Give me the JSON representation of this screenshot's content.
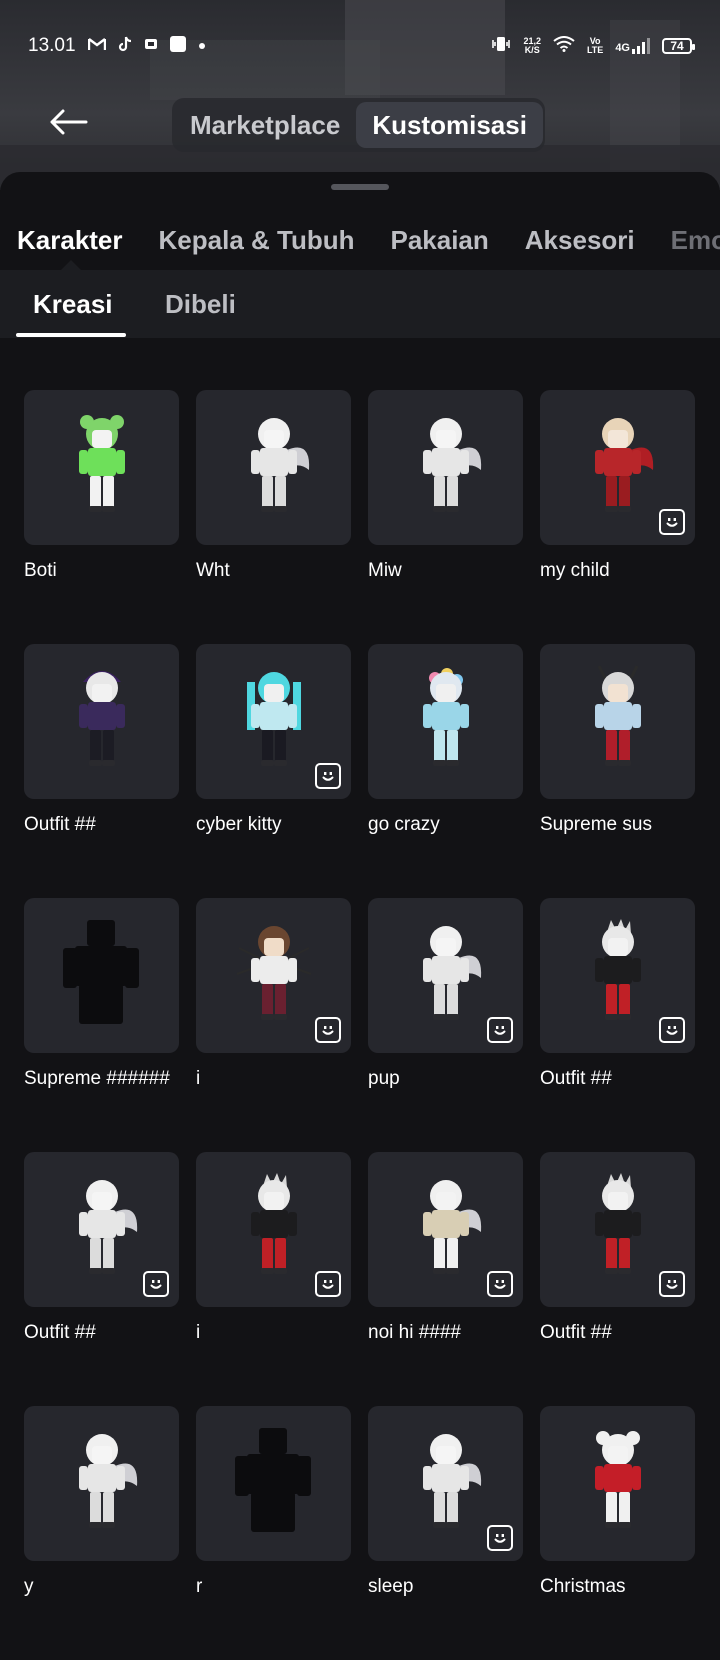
{
  "status": {
    "time": "13.01",
    "icons_left": [
      "gmail-icon",
      "tiktok-icon",
      "app-icon",
      "app-square-icon",
      "dot-icon"
    ],
    "net_speed_value": "21,2",
    "net_speed_unit": "K/S",
    "volte_top": "Vo",
    "volte_bottom": "LTE",
    "network": "4G",
    "battery": "74"
  },
  "header": {
    "back_icon": "arrow-left-icon",
    "segments": [
      {
        "label": "Marketplace",
        "active": false
      },
      {
        "label": "Kustomisasi",
        "active": true
      }
    ]
  },
  "category_tabs": [
    {
      "label": "Karakter",
      "active": true
    },
    {
      "label": "Kepala & Tubuh",
      "active": false
    },
    {
      "label": "Pakaian",
      "active": false
    },
    {
      "label": "Aksesori",
      "active": false
    },
    {
      "label": "Emo",
      "active": false
    }
  ],
  "sub_tabs": [
    {
      "label": "Kreasi",
      "active": true
    },
    {
      "label": "Dibeli",
      "active": false
    }
  ],
  "characters": [
    {
      "name": "Boti",
      "badge": false,
      "theme": "green"
    },
    {
      "name": "Wht",
      "badge": false,
      "theme": "white"
    },
    {
      "name": "Miw",
      "badge": false,
      "theme": "white"
    },
    {
      "name": "my child",
      "badge": true,
      "theme": "red"
    },
    {
      "name": "Outfit ##",
      "badge": false,
      "theme": "purple"
    },
    {
      "name": "cyber kitty",
      "badge": true,
      "theme": "cyan"
    },
    {
      "name": "go crazy",
      "badge": false,
      "theme": "balloon"
    },
    {
      "name": "Supreme sus",
      "badge": false,
      "theme": "lightblue"
    },
    {
      "name": "Supreme ######",
      "badge": false,
      "theme": "blank"
    },
    {
      "name": "i",
      "badge": true,
      "theme": "brown"
    },
    {
      "name": "pup",
      "badge": true,
      "theme": "white"
    },
    {
      "name": "Outfit ##",
      "badge": true,
      "theme": "black-red"
    },
    {
      "name": "Outfit ##",
      "badge": true,
      "theme": "white"
    },
    {
      "name": "i",
      "badge": true,
      "theme": "black-red"
    },
    {
      "name": "noi hi ####",
      "badge": true,
      "theme": "beige"
    },
    {
      "name": "Outfit ##",
      "badge": true,
      "theme": "black-red"
    },
    {
      "name": "y",
      "badge": false,
      "theme": "white"
    },
    {
      "name": "r",
      "badge": false,
      "theme": "blank"
    },
    {
      "name": "sleep",
      "badge": true,
      "theme": "white"
    },
    {
      "name": "Christmas",
      "badge": false,
      "theme": "christmas"
    }
  ],
  "colors": {
    "background": "#121215",
    "card": "#26272d",
    "sub_bar": "#1c1d21"
  }
}
